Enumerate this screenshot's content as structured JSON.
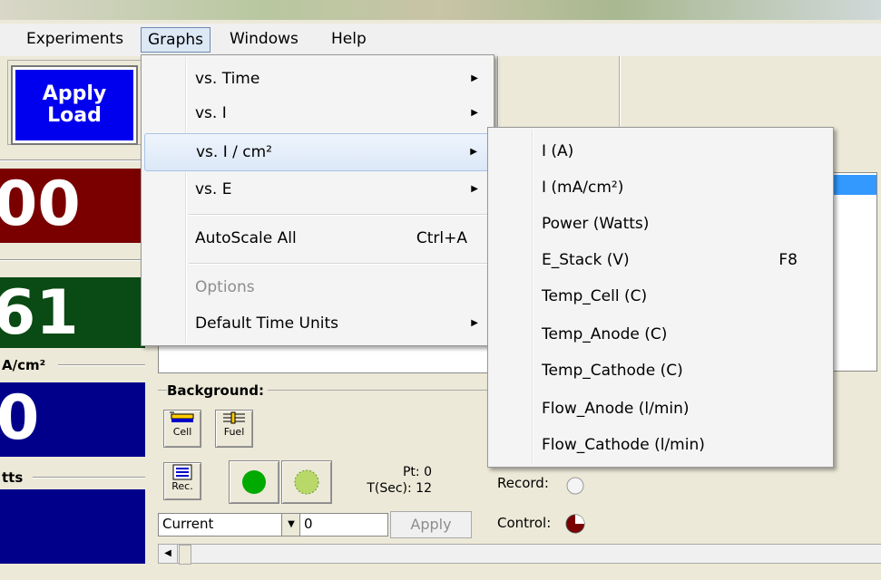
{
  "menubar": {
    "items": [
      "Experiments",
      "Graphs",
      "Windows",
      "Help"
    ]
  },
  "left_panel": {
    "apply_load_line1": "Apply",
    "apply_load_line2": "Load",
    "display1_value": "00",
    "display1_color": "#7a0000",
    "display2_value": "61",
    "display2_color": "#0a4a14",
    "unit_label_a": "A/cm²",
    "display3_value": "0",
    "display3_color": "#00008b",
    "unit_label_b": "tts",
    "display4_color": "#00008b"
  },
  "controls": {
    "background_label": "Background:",
    "cell_label": "Cell",
    "fuel_label": "Fuel",
    "rec_label": "Rec.",
    "pt_text": "Pt: 0",
    "tsec_text": "T(Sec): 12",
    "record_label": "Record:",
    "control_label": "Control:",
    "mode_select_value": "Current",
    "value_input": "0",
    "apply_label": "Apply"
  },
  "graphs_menu": {
    "items": [
      {
        "label": "vs. Time",
        "submenu": true
      },
      {
        "label": "vs. I",
        "submenu": true
      },
      {
        "label": "vs. I / cm²",
        "submenu": true,
        "highlighted": true
      },
      {
        "label": "vs. E",
        "submenu": true
      },
      {
        "label": "AutoScale All",
        "shortcut": "Ctrl+A"
      },
      {
        "label": "Options",
        "disabled": true
      },
      {
        "label": "Default Time Units",
        "submenu": true
      }
    ]
  },
  "submenu": {
    "items": [
      {
        "label": "I (A)"
      },
      {
        "label": "I (mA/cm²)"
      },
      {
        "label": "Power (Watts)"
      },
      {
        "label": "E_Stack (V)",
        "shortcut": "F8"
      },
      {
        "label": "Temp_Cell (C)"
      },
      {
        "label": "Temp_Anode (C)"
      },
      {
        "label": "Temp_Cathode (C)"
      },
      {
        "label": "Flow_Anode (l/min)"
      },
      {
        "label": "Flow_Cathode (l/min)"
      }
    ]
  },
  "icons": {
    "arrow_right": "submenu-arrow-icon",
    "green_dot": "green-status-icon",
    "record": "record-indicator-icon",
    "control": "control-pie-icon"
  }
}
